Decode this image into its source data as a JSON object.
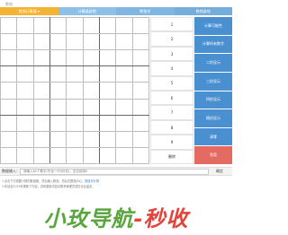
{
  "app": {
    "title": "数独"
  },
  "tabs": [
    {
      "label": "数独计算器 ▾"
    },
    {
      "label": "计算器说明"
    },
    {
      "label": "数独学"
    },
    {
      "label": "数独游戏"
    }
  ],
  "numpad": [
    "1",
    "2",
    "3",
    "4",
    "5",
    "6",
    "7",
    "8",
    "9",
    "删除"
  ],
  "actions": [
    {
      "label": "计算可能性"
    },
    {
      "label": "计算所有数字"
    },
    {
      "label": "二阶显示"
    },
    {
      "label": "三阶显示"
    },
    {
      "label": "四阶显示"
    },
    {
      "label": "随机显示"
    },
    {
      "label": "清零"
    },
    {
      "label": "答案"
    }
  ],
  "input": {
    "label": "数据输入：",
    "placeholder": "请输入81个数字(不足一行0补充)，空位则用0",
    "button": "确定"
  },
  "notes": {
    "line1_text": "①点击下方需要计算的数独格，然后输入数独，然后在数独中心，",
    "line1_link": "按钮可计算",
    "line2_text": "②本站自2019年更新了内容，具体更新内容请联系管理员或在论坛留言。"
  },
  "watermark": {
    "part_a": "小玫导航",
    "part_b": "-秒收"
  }
}
